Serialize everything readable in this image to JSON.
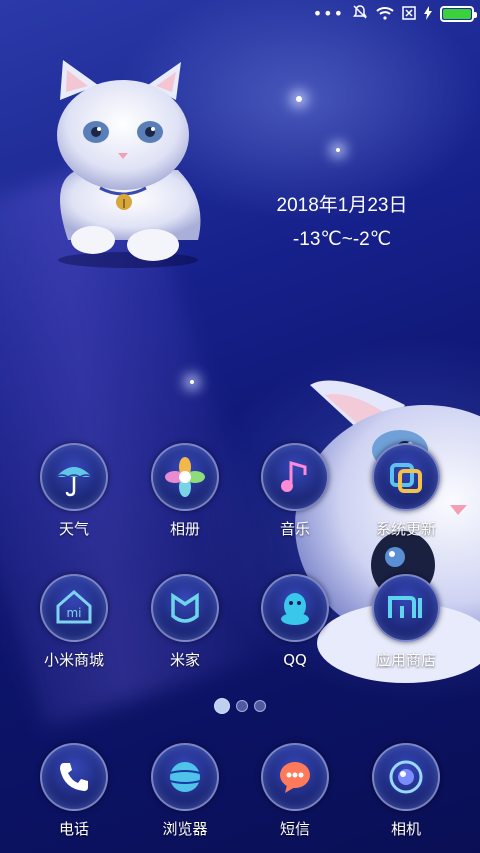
{
  "status_bar": {
    "more": "•••",
    "battery_level": 1.0
  },
  "widget": {
    "date": "2018年1月23日",
    "temperature": "-13℃~-2℃"
  },
  "apps_row1": [
    {
      "label": "天气",
      "icon": "umbrella-icon"
    },
    {
      "label": "相册",
      "icon": "flower-icon"
    },
    {
      "label": "音乐",
      "icon": "music-note-icon"
    },
    {
      "label": "系统更新",
      "icon": "update-icon"
    }
  ],
  "apps_row2": [
    {
      "label": "小米商城",
      "icon": "store-icon"
    },
    {
      "label": "米家",
      "icon": "mijia-icon"
    },
    {
      "label": "QQ",
      "icon": "qq-penguin-icon"
    },
    {
      "label": "应用商店",
      "icon": "mi-logo-icon"
    }
  ],
  "dock": [
    {
      "label": "电话",
      "icon": "phone-icon"
    },
    {
      "label": "浏览器",
      "icon": "browser-icon"
    },
    {
      "label": "短信",
      "icon": "message-icon"
    },
    {
      "label": "相机",
      "icon": "camera-icon"
    }
  ],
  "pager": {
    "pages": 3,
    "active": 0
  }
}
